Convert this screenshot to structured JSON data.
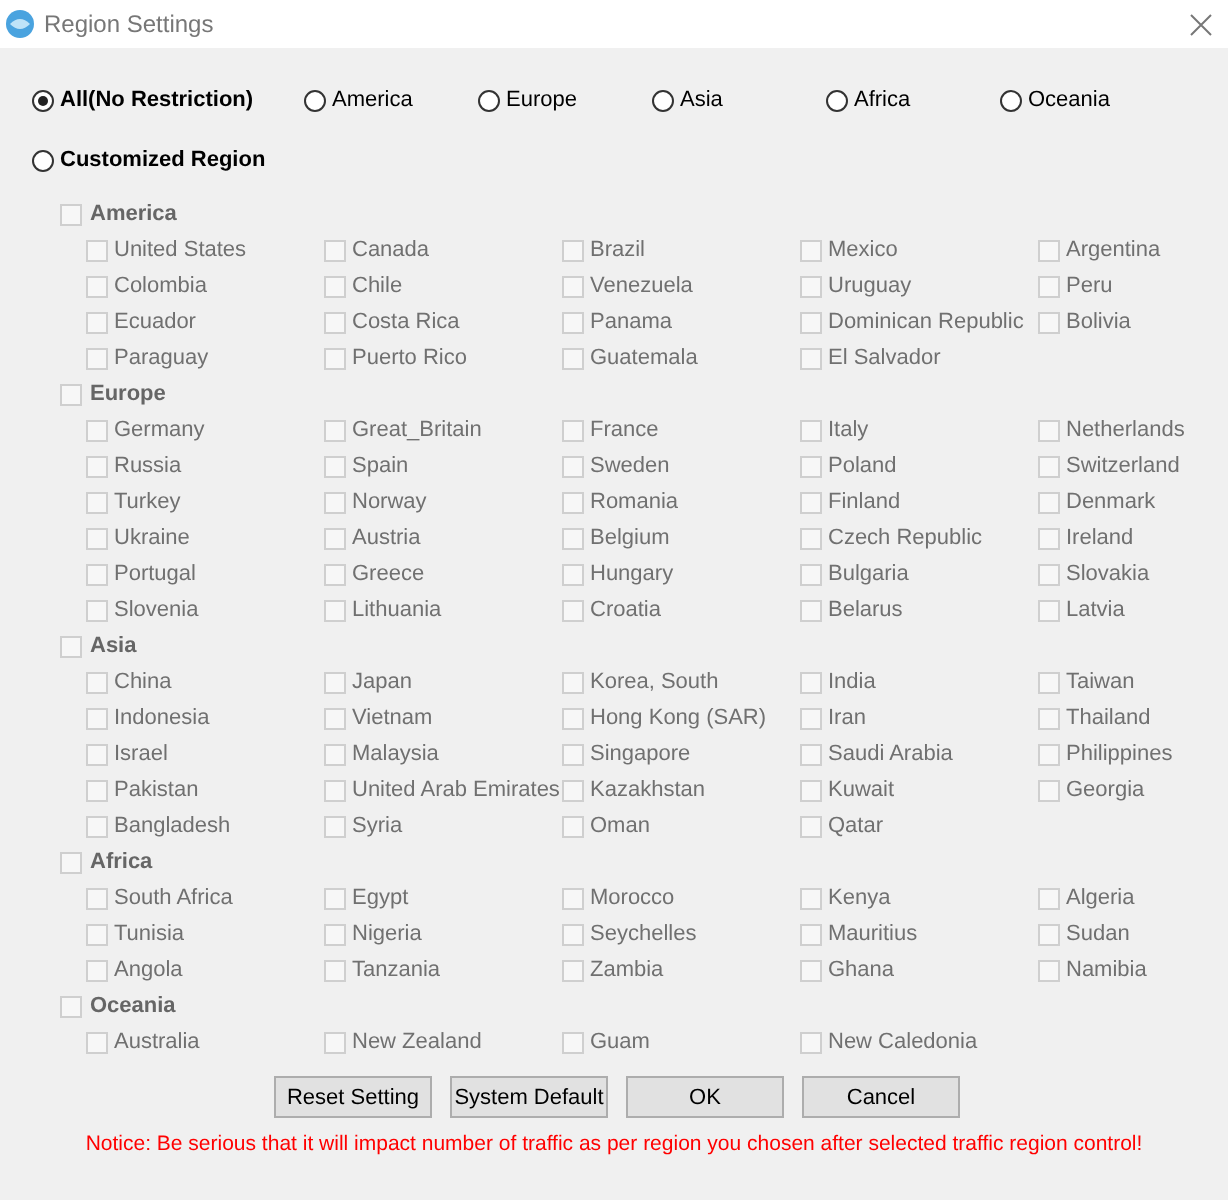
{
  "window": {
    "title": "Region Settings"
  },
  "modes": [
    {
      "label": "All(No Restriction)",
      "selected": true,
      "bold": true
    },
    {
      "label": "America",
      "selected": false,
      "bold": false
    },
    {
      "label": "Europe",
      "selected": false,
      "bold": false
    },
    {
      "label": "Asia",
      "selected": false,
      "bold": false
    },
    {
      "label": "Africa",
      "selected": false,
      "bold": false
    },
    {
      "label": "Oceania",
      "selected": false,
      "bold": false
    },
    {
      "label": "Customized Region",
      "selected": false,
      "bold": true
    }
  ],
  "groups": [
    {
      "label": "America",
      "checked": false,
      "disabled": true,
      "countries": [
        {
          "label": "United States",
          "checked": false
        },
        {
          "label": "Canada",
          "checked": false
        },
        {
          "label": "Brazil",
          "checked": false
        },
        {
          "label": "Mexico",
          "checked": false
        },
        {
          "label": "Argentina",
          "checked": false
        },
        {
          "label": "Colombia",
          "checked": false
        },
        {
          "label": "Chile",
          "checked": false
        },
        {
          "label": "Venezuela",
          "checked": false
        },
        {
          "label": "Uruguay",
          "checked": false
        },
        {
          "label": "Peru",
          "checked": false
        },
        {
          "label": "Ecuador",
          "checked": false
        },
        {
          "label": "Costa Rica",
          "checked": false
        },
        {
          "label": "Panama",
          "checked": false
        },
        {
          "label": "Dominican Republic",
          "checked": false
        },
        {
          "label": "Bolivia",
          "checked": false
        },
        {
          "label": "Paraguay",
          "checked": false
        },
        {
          "label": "Puerto Rico",
          "checked": false
        },
        {
          "label": "Guatemala",
          "checked": false
        },
        {
          "label": "El Salvador",
          "checked": false
        }
      ]
    },
    {
      "label": "Europe",
      "checked": false,
      "disabled": true,
      "countries": [
        {
          "label": "Germany",
          "checked": false
        },
        {
          "label": "Great_Britain",
          "checked": false
        },
        {
          "label": "France",
          "checked": false
        },
        {
          "label": "Italy",
          "checked": false
        },
        {
          "label": "Netherlands",
          "checked": false
        },
        {
          "label": "Russia",
          "checked": false
        },
        {
          "label": "Spain",
          "checked": false
        },
        {
          "label": "Sweden",
          "checked": false
        },
        {
          "label": "Poland",
          "checked": false
        },
        {
          "label": "Switzerland",
          "checked": false
        },
        {
          "label": "Turkey",
          "checked": false
        },
        {
          "label": "Norway",
          "checked": false
        },
        {
          "label": "Romania",
          "checked": false
        },
        {
          "label": "Finland",
          "checked": false
        },
        {
          "label": "Denmark",
          "checked": false
        },
        {
          "label": "Ukraine",
          "checked": false
        },
        {
          "label": "Austria",
          "checked": false
        },
        {
          "label": "Belgium",
          "checked": false
        },
        {
          "label": "Czech Republic",
          "checked": false
        },
        {
          "label": "Ireland",
          "checked": false
        },
        {
          "label": "Portugal",
          "checked": false
        },
        {
          "label": "Greece",
          "checked": false
        },
        {
          "label": "Hungary",
          "checked": false
        },
        {
          "label": "Bulgaria",
          "checked": false
        },
        {
          "label": "Slovakia",
          "checked": false
        },
        {
          "label": "Slovenia",
          "checked": false
        },
        {
          "label": "Lithuania",
          "checked": false
        },
        {
          "label": "Croatia",
          "checked": false
        },
        {
          "label": "Belarus",
          "checked": false
        },
        {
          "label": "Latvia",
          "checked": false
        }
      ]
    },
    {
      "label": "Asia",
      "checked": false,
      "disabled": true,
      "countries": [
        {
          "label": "China",
          "checked": false
        },
        {
          "label": "Japan",
          "checked": false
        },
        {
          "label": "Korea, South",
          "checked": false
        },
        {
          "label": "India",
          "checked": false
        },
        {
          "label": "Taiwan",
          "checked": false
        },
        {
          "label": "Indonesia",
          "checked": false
        },
        {
          "label": "Vietnam",
          "checked": false
        },
        {
          "label": "Hong Kong (SAR)",
          "checked": false
        },
        {
          "label": "Iran",
          "checked": false
        },
        {
          "label": "Thailand",
          "checked": false
        },
        {
          "label": "Israel",
          "checked": false
        },
        {
          "label": "Malaysia",
          "checked": false
        },
        {
          "label": "Singapore",
          "checked": false
        },
        {
          "label": "Saudi Arabia",
          "checked": false
        },
        {
          "label": "Philippines",
          "checked": false
        },
        {
          "label": "Pakistan",
          "checked": false
        },
        {
          "label": "United Arab Emirates",
          "checked": false
        },
        {
          "label": "Kazakhstan",
          "checked": false
        },
        {
          "label": "Kuwait",
          "checked": false
        },
        {
          "label": "Georgia",
          "checked": false
        },
        {
          "label": "Bangladesh",
          "checked": false
        },
        {
          "label": "Syria",
          "checked": false
        },
        {
          "label": "Oman",
          "checked": false
        },
        {
          "label": "Qatar",
          "checked": false
        }
      ]
    },
    {
      "label": "Africa",
      "checked": false,
      "disabled": true,
      "countries": [
        {
          "label": "South Africa",
          "checked": false
        },
        {
          "label": "Egypt",
          "checked": false
        },
        {
          "label": "Morocco",
          "checked": false
        },
        {
          "label": "Kenya",
          "checked": false
        },
        {
          "label": "Algeria",
          "checked": false
        },
        {
          "label": "Tunisia",
          "checked": false
        },
        {
          "label": "Nigeria",
          "checked": false
        },
        {
          "label": "Seychelles",
          "checked": false
        },
        {
          "label": "Mauritius",
          "checked": false
        },
        {
          "label": "Sudan",
          "checked": false
        },
        {
          "label": "Angola",
          "checked": false
        },
        {
          "label": "Tanzania",
          "checked": false
        },
        {
          "label": "Zambia",
          "checked": false
        },
        {
          "label": "Ghana",
          "checked": false
        },
        {
          "label": "Namibia",
          "checked": false
        }
      ]
    },
    {
      "label": "Oceania",
      "checked": false,
      "disabled": true,
      "countries": [
        {
          "label": "Australia",
          "checked": false
        },
        {
          "label": "New Zealand",
          "checked": false
        },
        {
          "label": "Guam",
          "checked": false
        },
        {
          "label": "New Caledonia",
          "checked": false
        }
      ]
    }
  ],
  "buttons": [
    "Reset Setting",
    "System Default",
    "OK",
    "Cancel"
  ],
  "notice": "Notice: Be serious that it will impact number of traffic as per region you chosen after selected traffic region control!"
}
